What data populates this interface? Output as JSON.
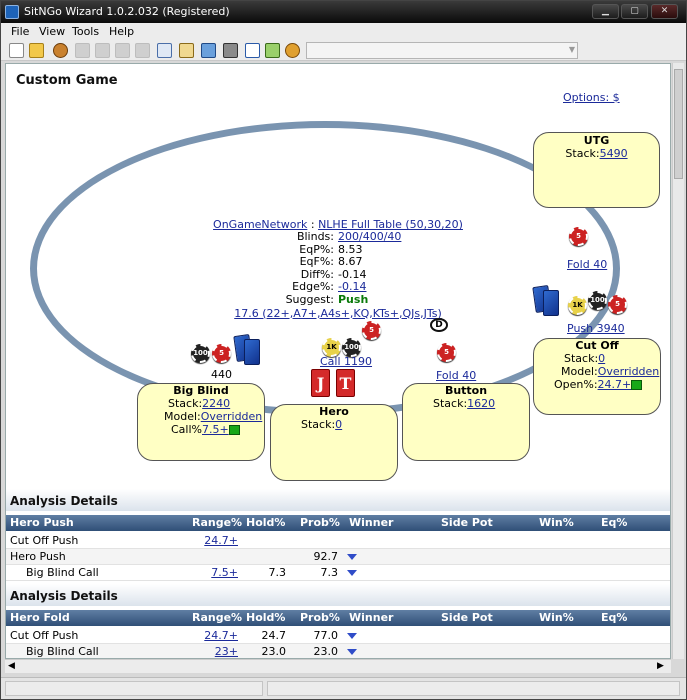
{
  "window": {
    "title": "SitNGo Wizard 1.0.2.032 (Registered)",
    "min_label": "▁",
    "max_label": "▢",
    "close_label": "✕"
  },
  "menu": [
    "File",
    "View",
    "Tools",
    "Help"
  ],
  "game": {
    "title": "Custom Game",
    "options_link": "Options: $",
    "info": {
      "network": "OnGameNetwork",
      "sep": " : ",
      "table": "NLHE Full Table (50,30,20)",
      "rows": [
        {
          "label": "Blinds:",
          "value": "200/400/40",
          "link": true
        },
        {
          "label": "EqP%:",
          "value": "8.53",
          "link": false
        },
        {
          "label": "EqF%:",
          "value": "8.67",
          "link": false
        },
        {
          "label": "Diff%:",
          "value": "-0.14",
          "link": false
        },
        {
          "label": "Edge%:",
          "value": "-0.14",
          "link": true
        },
        {
          "label": "Suggest:",
          "value": "Push",
          "link": false
        }
      ],
      "range": "17.6 (22+,A7+,A4s+,KQ,KTs+,QJs,JTs)"
    },
    "seats": {
      "utg": {
        "name": "UTG",
        "stack_label": "Stack:",
        "stack": "5490",
        "action": "Fold 40"
      },
      "cutoff": {
        "name": "Cut Off",
        "stack_label": "Stack:",
        "stack": "0",
        "model_label": "Model:",
        "model": "Overridden",
        "open_label": "Open%:",
        "open": "24.7+",
        "action": "Push 3940"
      },
      "button": {
        "name": "Button",
        "stack_label": "Stack:",
        "stack": "1620",
        "action": "Fold 40"
      },
      "hero": {
        "name": "Hero",
        "stack_label": "Stack:",
        "stack": "0",
        "action": "Call 1190",
        "cards": [
          "J",
          "T"
        ]
      },
      "bigblind": {
        "name": "Big Blind",
        "stack_label": "Stack:",
        "stack": "2240",
        "model_label": "Model:",
        "model": "Overridden",
        "call_label": "Call%",
        "call": "7.5+",
        "amount": "440"
      }
    },
    "chip_labels": {
      "five": "5",
      "hundred": "100",
      "thousand": "1K"
    },
    "dealer": "D"
  },
  "analysis": [
    {
      "title": "Analysis Details",
      "columns": [
        "Hero Push",
        "Range%",
        "Hold%",
        "Prob%",
        "Winner",
        "Side Pot",
        "Win%",
        "Eq%"
      ],
      "rows": [
        {
          "name": "Cut Off Push",
          "range": "24.7+",
          "hold": "",
          "prob": "",
          "arrow": false,
          "indent": false
        },
        {
          "name": "Hero Push",
          "range": "",
          "hold": "",
          "prob": "92.7",
          "arrow": true,
          "indent": false
        },
        {
          "name": "Big Blind Call",
          "range": "7.5+",
          "hold": "7.3",
          "prob": "7.3",
          "arrow": true,
          "indent": true
        }
      ]
    },
    {
      "title": "Analysis Details",
      "columns": [
        "Hero Fold",
        "Range%",
        "Hold%",
        "Prob%",
        "Winner",
        "Side Pot",
        "Win%",
        "Eq%"
      ],
      "rows": [
        {
          "name": "Cut Off Push",
          "range": "24.7+",
          "hold": "24.7",
          "prob": "77.0",
          "arrow": true,
          "indent": false
        },
        {
          "name": "Big Blind Call",
          "range": "23+",
          "hold": "23.0",
          "prob": "23.0",
          "arrow": true,
          "indent": true
        }
      ]
    }
  ],
  "colors": {
    "table_rim": "#7a94b0",
    "seat_fill": "#ffffc4",
    "grid_header": "#2f4f77",
    "link": "#1b2a9a",
    "suggest": "#0a7a0a"
  }
}
